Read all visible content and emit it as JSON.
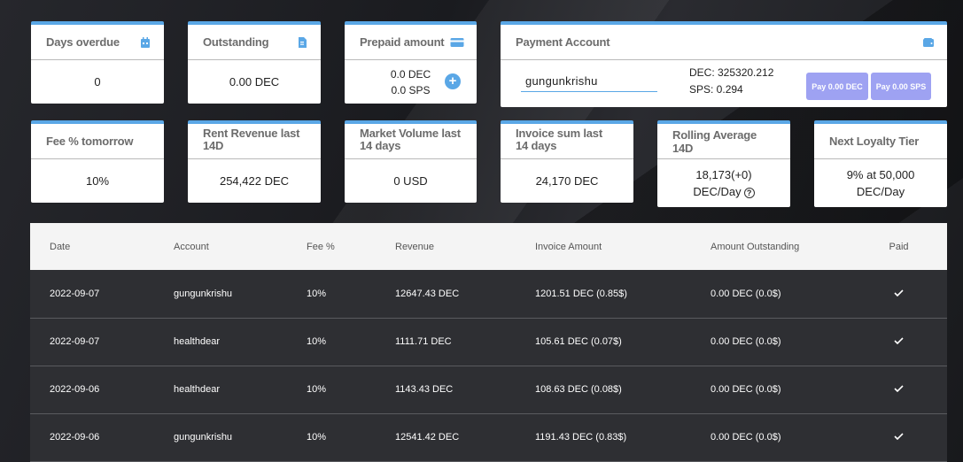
{
  "cards_row1": {
    "days_overdue": {
      "title": "Days overdue",
      "value": "0",
      "icon": "calendar-icon"
    },
    "outstanding": {
      "title": "Outstanding",
      "value": "0.00 DEC",
      "icon": "document-icon"
    },
    "prepaid": {
      "title": "Prepaid amount",
      "dec": "0.0 DEC",
      "sps": "0.0 SPS",
      "icon": "credit-card-icon",
      "add": "+"
    },
    "payment_account": {
      "title": "Payment Account",
      "icon": "wallet-icon",
      "account_value": "gungunkrishu",
      "dec_balance": "DEC: 325320.212",
      "sps_balance": "SPS: 0.294",
      "pay_dec_label": "Pay 0.00 DEC",
      "pay_sps_label": "Pay 0.00 SPS"
    }
  },
  "cards_row2": [
    {
      "title": "Fee % tomorrow",
      "value": "10%"
    },
    {
      "title": "Rent Revenue last 14D",
      "value": "254,422 DEC"
    },
    {
      "title": "Market Volume last 14 days",
      "value": "0 USD"
    },
    {
      "title": "Invoice sum last 14 days",
      "value": "24,170 DEC"
    },
    {
      "title": "Rolling Average 14D",
      "value_line1": "18,173(+0)",
      "value_line2": "DEC/Day",
      "help": "?"
    },
    {
      "title": "Next Loyalty Tier",
      "value_line1": "9% at 50,000",
      "value_line2": "DEC/Day"
    }
  ],
  "table": {
    "headers": [
      "Date",
      "Account",
      "Fee %",
      "Revenue",
      "Invoice Amount",
      "Amount Outstanding",
      "Paid"
    ],
    "rows": [
      [
        "2022-09-07",
        "gungunkrishu",
        "10%",
        "12647.43 DEC",
        "1201.51 DEC (0.85$)",
        "0.00 DEC (0.0$)"
      ],
      [
        "2022-09-07",
        "healthdear",
        "10%",
        "1111.71 DEC",
        "105.61 DEC (0.07$)",
        "0.00 DEC (0.0$)"
      ],
      [
        "2022-09-06",
        "healthdear",
        "10%",
        "1143.43 DEC",
        "108.63 DEC (0.08$)",
        "0.00 DEC (0.0$)"
      ],
      [
        "2022-09-06",
        "gungunkrishu",
        "10%",
        "12541.42 DEC",
        "1191.43 DEC (0.83$)",
        "0.00 DEC (0.0$)"
      ]
    ]
  },
  "colors": {
    "accent": "#5aa7e6",
    "pay_button": "#9ea2f2",
    "row_bg": "#2e2f33"
  }
}
